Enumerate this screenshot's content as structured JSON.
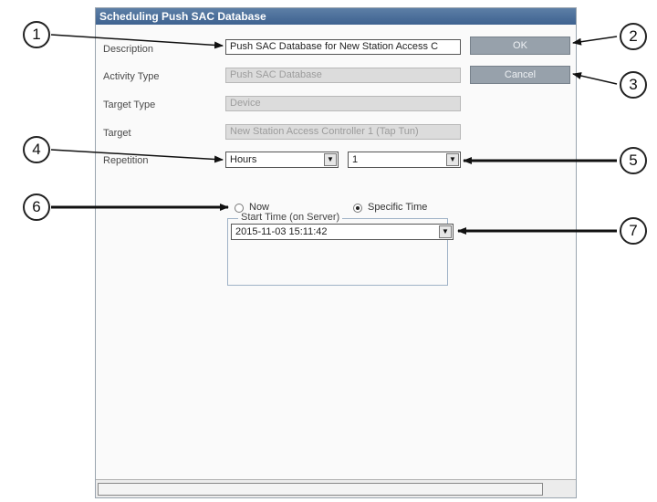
{
  "dialog": {
    "title": "Scheduling Push SAC Database",
    "labels": {
      "description": "Description",
      "activity_type": "Activity Type",
      "target_type": "Target Type",
      "target": "Target",
      "repetition": "Repetition"
    },
    "description_value": "Push SAC Database for New Station Access C",
    "activity_type_value": "Push SAC Database",
    "target_type_value": "Device",
    "target_value": "New Station Access Controller 1 (Tap Tun)",
    "repetition_unit": "Hours",
    "repetition_count": "1",
    "ok_label": "OK",
    "cancel_label": "Cancel",
    "start_time": {
      "legend": "Start Time (on Server)",
      "now_label": "Now",
      "specific_label": "Specific Time",
      "selected": "specific",
      "datetime_value": "2015-11-03  15:11:42"
    }
  },
  "callouts": [
    "1",
    "2",
    "3",
    "4",
    "5",
    "6",
    "7"
  ]
}
